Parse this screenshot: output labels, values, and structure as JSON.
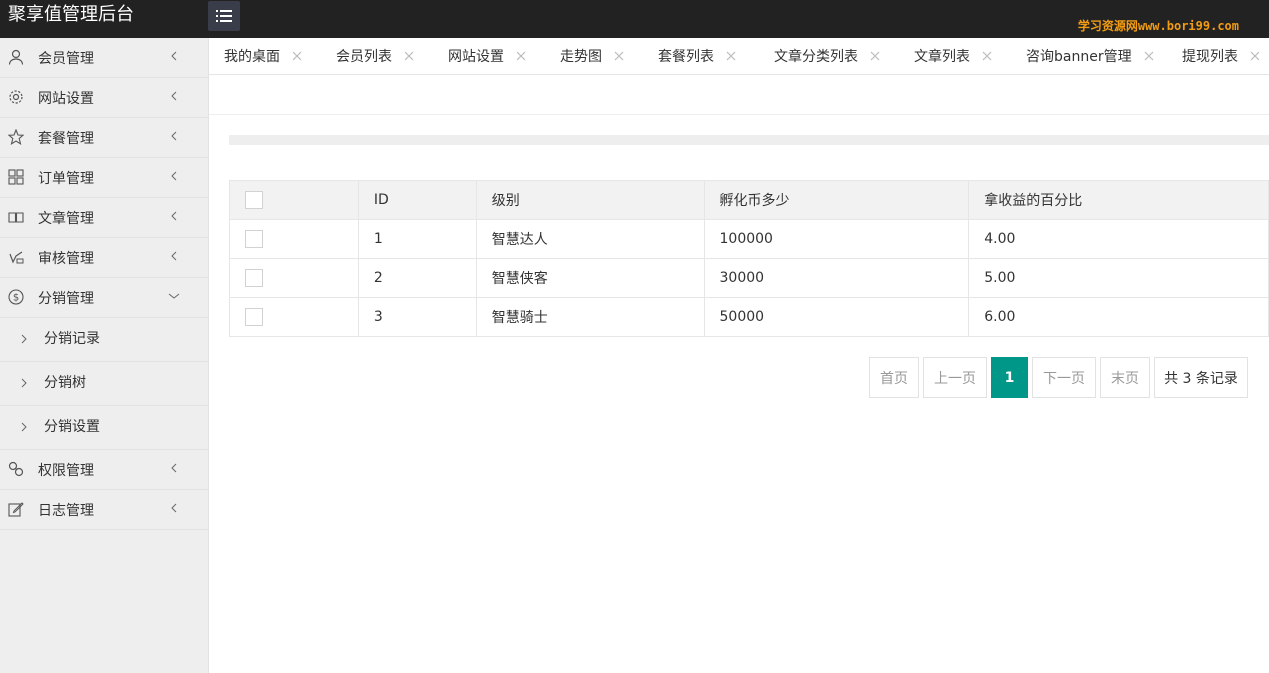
{
  "header": {
    "title": "聚享值管理后台",
    "watermark": "学习资源网www.bori99.com"
  },
  "sidebar": {
    "items": [
      {
        "label": "会员管理",
        "icon": "user-icon"
      },
      {
        "label": "网站设置",
        "icon": "gear-icon"
      },
      {
        "label": "套餐管理",
        "icon": "star-icon"
      },
      {
        "label": "订单管理",
        "icon": "grid-icon"
      },
      {
        "label": "文章管理",
        "icon": "book-icon"
      },
      {
        "label": "审核管理",
        "icon": "approve-icon"
      },
      {
        "label": "分销管理",
        "icon": "dollar-icon",
        "expanded": true,
        "children": [
          {
            "label": "分销记录"
          },
          {
            "label": "分销树"
          },
          {
            "label": "分销设置"
          }
        ]
      },
      {
        "label": "权限管理",
        "icon": "link-icon"
      },
      {
        "label": "日志管理",
        "icon": "edit-icon"
      }
    ]
  },
  "tabs": [
    {
      "label": "我的桌面"
    },
    {
      "label": "会员列表"
    },
    {
      "label": "网站设置"
    },
    {
      "label": "走势图"
    },
    {
      "label": "套餐列表"
    },
    {
      "label": "文章分类列表"
    },
    {
      "label": "文章列表"
    },
    {
      "label": "咨询banner管理"
    },
    {
      "label": "提现列表"
    }
  ],
  "table": {
    "columns": [
      "ID",
      "级别",
      "孵化币多少",
      "拿收益的百分比"
    ],
    "rows": [
      {
        "id": "1",
        "level": "智慧达人",
        "coins": "100000",
        "percent": "4.00"
      },
      {
        "id": "2",
        "level": "智慧侠客",
        "coins": "30000",
        "percent": "5.00"
      },
      {
        "id": "3",
        "level": "智慧骑士",
        "coins": "50000",
        "percent": "6.00"
      }
    ]
  },
  "pagination": {
    "first": "首页",
    "prev": "上一页",
    "current": "1",
    "next": "下一页",
    "last": "末页",
    "total": "共 3 条记录"
  },
  "colors": {
    "header_bg": "#222222",
    "sidebar_bg": "#EEEEEE",
    "accent": "#009688",
    "watermark": "#f39c12"
  }
}
